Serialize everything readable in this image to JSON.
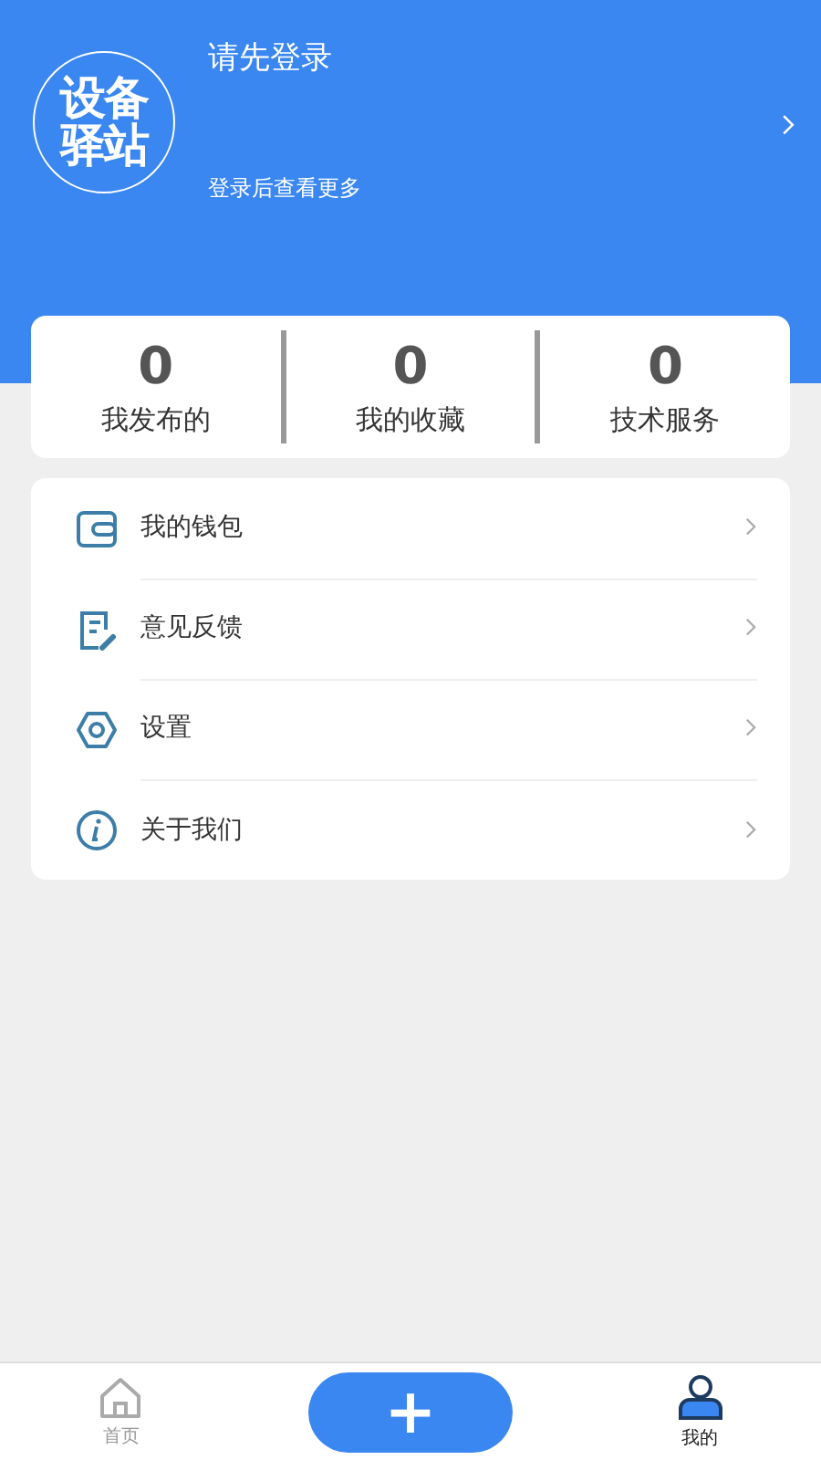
{
  "profile": {
    "logo_lines": [
      "设备",
      "驿站"
    ],
    "title": "请先登录",
    "subtitle": "登录后查看更多"
  },
  "stats": [
    {
      "value": "0",
      "label": "我发布的"
    },
    {
      "value": "0",
      "label": "我的收藏"
    },
    {
      "value": "0",
      "label": "技术服务"
    }
  ],
  "menu": [
    {
      "kind": "wallet",
      "label": "我的钱包"
    },
    {
      "kind": "feedback",
      "label": "意见反馈"
    },
    {
      "kind": "settings",
      "label": "设置"
    },
    {
      "kind": "about",
      "label": "关于我们"
    }
  ],
  "tab_bar": {
    "tabs": [
      {
        "kind": "home",
        "label": "首页",
        "selected": false
      },
      {
        "kind": "add",
        "label": "+"
      },
      {
        "kind": "profile",
        "label": "我的",
        "selected": true
      }
    ]
  }
}
